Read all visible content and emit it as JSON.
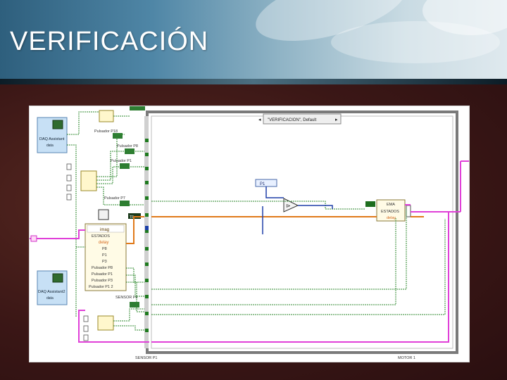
{
  "slide": {
    "title": "VERIFICACIÓN"
  },
  "diagram": {
    "daq1": {
      "title": "DAQ Assistant",
      "output": "data"
    },
    "daq2": {
      "title": "DAQ Assistant2",
      "output": "data"
    },
    "case_selector": "\"VERIFICACION\", Default",
    "labels": {
      "pulsador_p18": "Pulsador P18",
      "pulsador_p8": "Pulsador P8",
      "pulsador_p1": "Pulsador P1",
      "pulsador_p7": "Pulsador P7",
      "sensor_p8": "SENSOR P8",
      "sensor_p1": "SENSOR P1",
      "motor_1": "MOTOR 1",
      "p1_small": "P1",
      "true_const": "TF"
    },
    "cluster_in": [
      "imag",
      "ESTADOS",
      "delay",
      "P8",
      "P1",
      "P3",
      "Pulsador P8",
      "Pulsador P1",
      "Pulsador P3",
      "Pulsador P1 2"
    ],
    "cluster_out": [
      "EMA",
      "ESTADOS",
      "delay"
    ]
  }
}
